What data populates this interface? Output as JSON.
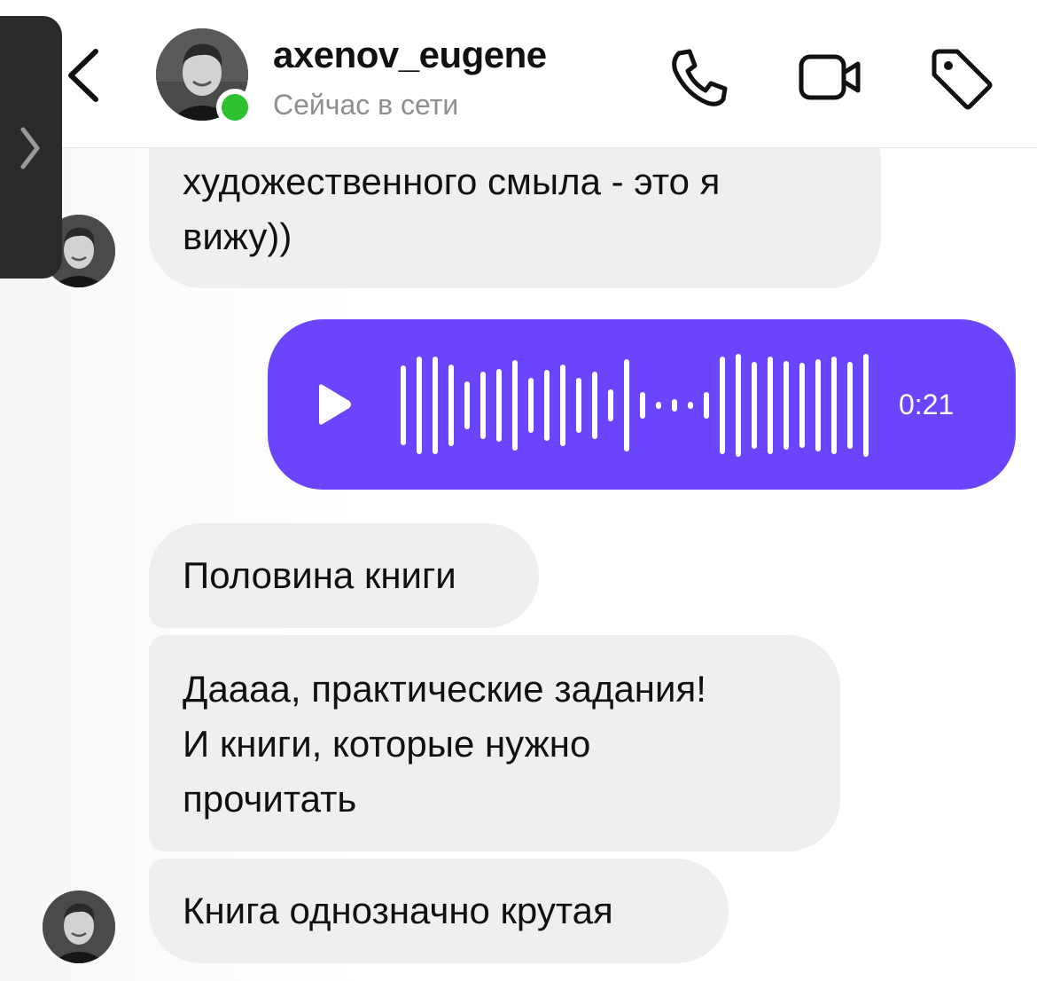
{
  "header": {
    "username": "axenov_eugene",
    "status": "Сейчас в сети",
    "icons": [
      "back-chevron-icon",
      "phone-icon",
      "video-camera-icon",
      "tag-icon"
    ]
  },
  "drawer": {
    "icon": "chevron-right-icon"
  },
  "messages": [
    {
      "from": "contact",
      "lines": [
        "художественного смыла - это я",
        "вижу))"
      ]
    },
    {
      "from": "me",
      "type": "voice",
      "duration": "0:21",
      "icon": "play-icon"
    },
    {
      "from": "contact",
      "text": "Половина книги"
    },
    {
      "from": "contact",
      "lines": [
        "Даааа, практические задания!",
        "И книги, которые нужно",
        "прочитать"
      ]
    },
    {
      "from": "contact",
      "text": "Книга однозначно крутая"
    }
  ],
  "colors": {
    "voice_bubble": "#6a45fc",
    "incoming_bubble": "#efefef",
    "online": "#2fc12f",
    "status_text": "#8e8e93"
  }
}
